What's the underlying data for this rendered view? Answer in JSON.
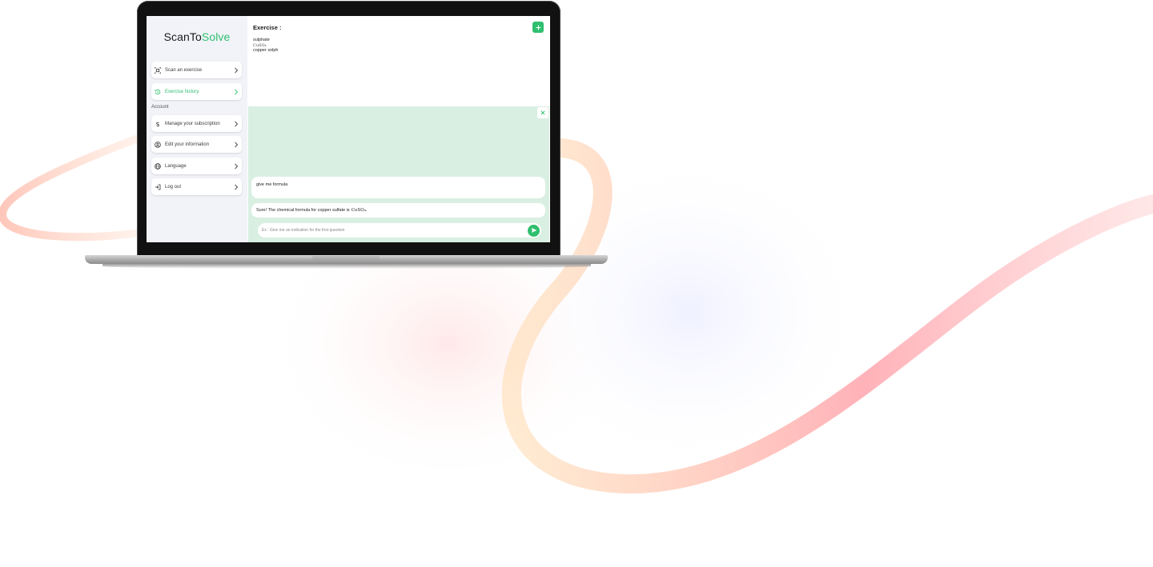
{
  "app": {
    "brand_prefix": "ScanTo",
    "brand_accent": "Solve",
    "accent_color": "#2fbf6f"
  },
  "sidebar": {
    "items": [
      {
        "label": "Scan an exercise",
        "icon": "scan-icon",
        "active": false
      },
      {
        "label": "Exercise history",
        "icon": "history-icon",
        "active": true
      }
    ],
    "section_label": "Account",
    "account_items": [
      {
        "label": "Manage your subscription",
        "icon": "dollar-icon"
      },
      {
        "label": "Edit your information",
        "icon": "user-circle-icon"
      },
      {
        "label": "Language",
        "icon": "globe-icon"
      },
      {
        "label": "Log out",
        "icon": "logout-icon"
      }
    ]
  },
  "exercise": {
    "title": "Exercise :",
    "line1": "sulphate",
    "formula": "CuSO₄",
    "line3": "copper solph",
    "add_icon": "plus-icon"
  },
  "chat": {
    "close_icon": "close-icon",
    "user_message": "give me formula",
    "bot_message": "Sure! The chemical formula for copper sulfate is",
    "bot_formula": "CuSO₄.",
    "input_placeholder": "Ex : Give me an indication for the first question",
    "send_icon": "send-icon"
  }
}
